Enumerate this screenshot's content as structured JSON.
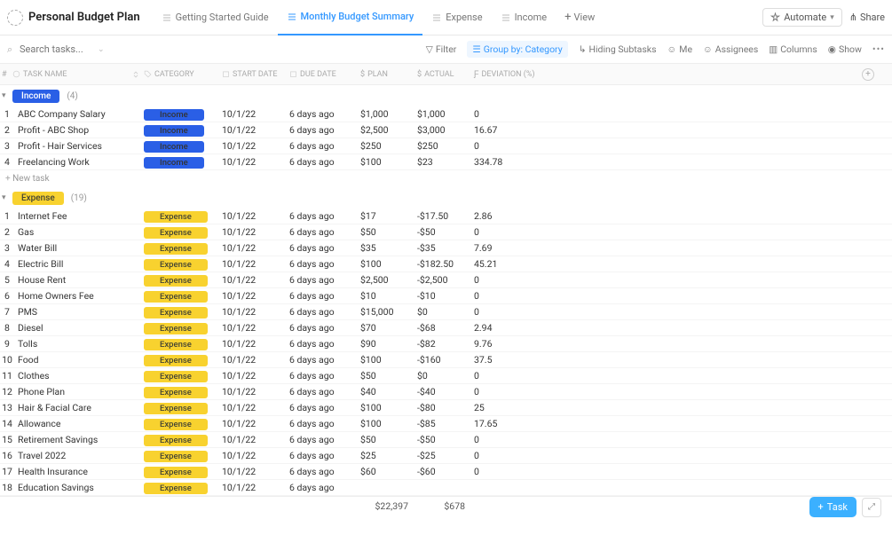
{
  "header": {
    "title": "Personal Budget Plan",
    "tabs": [
      {
        "label": "Getting Started Guide",
        "active": false
      },
      {
        "label": "Monthly Budget Summary",
        "active": true
      },
      {
        "label": "Expense",
        "active": false
      },
      {
        "label": "Income",
        "active": false
      }
    ],
    "add_view": "View",
    "automate": "Automate",
    "share": "Share"
  },
  "toolbar": {
    "search_placeholder": "Search tasks...",
    "filter": "Filter",
    "group_by": "Group by: Category",
    "hiding_subtasks": "Hiding Subtasks",
    "me": "Me",
    "assignees": "Assignees",
    "columns": "Columns",
    "show": "Show"
  },
  "columns": {
    "idx": "#",
    "task_name": "TASK NAME",
    "category": "CATEGORY",
    "start_date": "START DATE",
    "due_date": "DUE DATE",
    "plan": "PLAN",
    "actual": "ACTUAL",
    "deviation": "DEVIATION (%)"
  },
  "groups": [
    {
      "name": "Income",
      "pill_class": "pill-income",
      "count": "(4)",
      "rows": [
        {
          "idx": "1",
          "name": "ABC Company Salary",
          "cat": "Income",
          "pill": "pill-income",
          "start": "10/1/22",
          "due": "6 days ago",
          "plan": "$1,000",
          "actual": "$1,000",
          "dev": "0"
        },
        {
          "idx": "2",
          "name": "Profit - ABC Shop",
          "cat": "Income",
          "pill": "pill-income",
          "start": "10/1/22",
          "due": "6 days ago",
          "plan": "$2,500",
          "actual": "$3,000",
          "dev": "16.67"
        },
        {
          "idx": "3",
          "name": "Profit - Hair Services",
          "cat": "Income",
          "pill": "pill-income",
          "start": "10/1/22",
          "due": "6 days ago",
          "plan": "$250",
          "actual": "$250",
          "dev": "0"
        },
        {
          "idx": "4",
          "name": "Freelancing Work",
          "cat": "Income",
          "pill": "pill-income",
          "start": "10/1/22",
          "due": "6 days ago",
          "plan": "$100",
          "actual": "$23",
          "dev": "334.78"
        }
      ],
      "show_new_task": true
    },
    {
      "name": "Expense",
      "pill_class": "pill-expense",
      "count": "(19)",
      "rows": [
        {
          "idx": "1",
          "name": "Internet Fee",
          "cat": "Expense",
          "pill": "pill-expense",
          "start": "10/1/22",
          "due": "6 days ago",
          "plan": "$17",
          "actual": "-$17.50",
          "dev": "2.86"
        },
        {
          "idx": "2",
          "name": "Gas",
          "cat": "Expense",
          "pill": "pill-expense",
          "start": "10/1/22",
          "due": "6 days ago",
          "plan": "$50",
          "actual": "-$50",
          "dev": "0"
        },
        {
          "idx": "3",
          "name": "Water Bill",
          "cat": "Expense",
          "pill": "pill-expense",
          "start": "10/1/22",
          "due": "6 days ago",
          "plan": "$35",
          "actual": "-$35",
          "dev": "7.69"
        },
        {
          "idx": "4",
          "name": "Electric Bill",
          "cat": "Expense",
          "pill": "pill-expense",
          "start": "10/1/22",
          "due": "6 days ago",
          "plan": "$100",
          "actual": "-$182.50",
          "dev": "45.21"
        },
        {
          "idx": "5",
          "name": "House Rent",
          "cat": "Expense",
          "pill": "pill-expense",
          "start": "10/1/22",
          "due": "6 days ago",
          "plan": "$2,500",
          "actual": "-$2,500",
          "dev": "0"
        },
        {
          "idx": "6",
          "name": "Home Owners Fee",
          "cat": "Expense",
          "pill": "pill-expense",
          "start": "10/1/22",
          "due": "6 days ago",
          "plan": "$10",
          "actual": "-$10",
          "dev": "0"
        },
        {
          "idx": "7",
          "name": "PMS",
          "cat": "Expense",
          "pill": "pill-expense",
          "start": "10/1/22",
          "due": "6 days ago",
          "plan": "$15,000",
          "actual": "$0",
          "dev": "0"
        },
        {
          "idx": "8",
          "name": "Diesel",
          "cat": "Expense",
          "pill": "pill-expense",
          "start": "10/1/22",
          "due": "6 days ago",
          "plan": "$70",
          "actual": "-$68",
          "dev": "2.94"
        },
        {
          "idx": "9",
          "name": "Tolls",
          "cat": "Expense",
          "pill": "pill-expense",
          "start": "10/1/22",
          "due": "6 days ago",
          "plan": "$90",
          "actual": "-$82",
          "dev": "9.76"
        },
        {
          "idx": "10",
          "name": "Food",
          "cat": "Expense",
          "pill": "pill-expense",
          "start": "10/1/22",
          "due": "6 days ago",
          "plan": "$100",
          "actual": "-$160",
          "dev": "37.5"
        },
        {
          "idx": "11",
          "name": "Clothes",
          "cat": "Expense",
          "pill": "pill-expense",
          "start": "10/1/22",
          "due": "6 days ago",
          "plan": "$50",
          "actual": "$0",
          "dev": "0"
        },
        {
          "idx": "12",
          "name": "Phone Plan",
          "cat": "Expense",
          "pill": "pill-expense",
          "start": "10/1/22",
          "due": "6 days ago",
          "plan": "$40",
          "actual": "-$40",
          "dev": "0"
        },
        {
          "idx": "13",
          "name": "Hair & Facial Care",
          "cat": "Expense",
          "pill": "pill-expense",
          "start": "10/1/22",
          "due": "6 days ago",
          "plan": "$100",
          "actual": "-$80",
          "dev": "25"
        },
        {
          "idx": "14",
          "name": "Allowance",
          "cat": "Expense",
          "pill": "pill-expense",
          "start": "10/1/22",
          "due": "6 days ago",
          "plan": "$100",
          "actual": "-$85",
          "dev": "17.65"
        },
        {
          "idx": "15",
          "name": "Retirement Savings",
          "cat": "Expense",
          "pill": "pill-expense",
          "start": "10/1/22",
          "due": "6 days ago",
          "plan": "$50",
          "actual": "-$50",
          "dev": "0"
        },
        {
          "idx": "16",
          "name": "Travel 2022",
          "cat": "Expense",
          "pill": "pill-expense",
          "start": "10/1/22",
          "due": "6 days ago",
          "plan": "$25",
          "actual": "-$25",
          "dev": "0"
        },
        {
          "idx": "17",
          "name": "Health Insurance",
          "cat": "Expense",
          "pill": "pill-expense",
          "start": "10/1/22",
          "due": "6 days ago",
          "plan": "$60",
          "actual": "-$60",
          "dev": "0"
        },
        {
          "idx": "18",
          "name": "Education Savings",
          "cat": "Expense",
          "pill": "pill-expense",
          "start": "10/1/22",
          "due": "6 days ago",
          "plan": "",
          "actual": "",
          "dev": ""
        }
      ],
      "show_new_task": false
    }
  ],
  "new_task_label": "New task",
  "totals": {
    "plan": "$22,397",
    "actual": "$678"
  },
  "fab": {
    "task": "Task"
  }
}
